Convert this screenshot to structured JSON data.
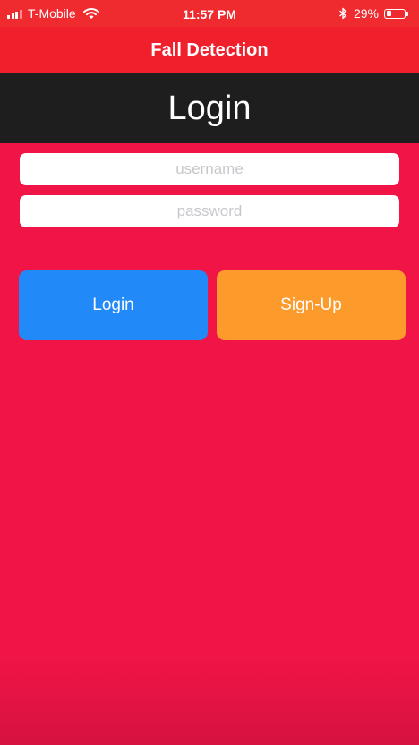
{
  "status_bar": {
    "carrier": "T-Mobile",
    "time": "11:57 PM",
    "battery_percent_label": "29%",
    "battery_level": 0.29,
    "signal_bars_filled": 3,
    "signal_bars_total": 4,
    "icons": [
      "signal-icon",
      "wifi-icon",
      "bluetooth-icon",
      "battery-icon"
    ]
  },
  "nav": {
    "title": "Fall Detection"
  },
  "header": {
    "title": "Login"
  },
  "form": {
    "username_placeholder": "username",
    "username_value": "",
    "password_placeholder": "password",
    "password_value": ""
  },
  "buttons": {
    "login_label": "Login",
    "signup_label": "Sign-Up"
  },
  "colors": {
    "background": "#f01546",
    "status_bar": "#ef2b2f",
    "nav_bar": "#ef1f2b",
    "header_band": "#1e1e1e",
    "login_button": "#2189f8",
    "signup_button": "#fc9a2c"
  }
}
